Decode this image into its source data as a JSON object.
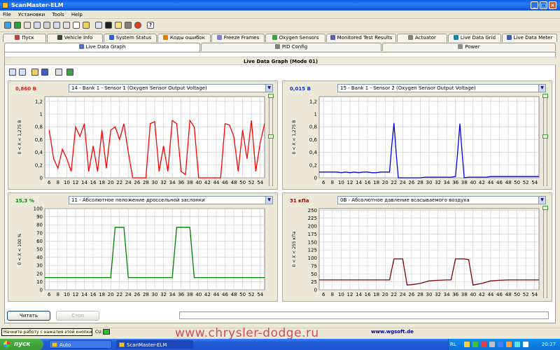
{
  "window": {
    "title": "ScanMaster-ELM"
  },
  "menu": [
    "File",
    "Установки",
    "Tools",
    "Help"
  ],
  "tabs_row1": [
    {
      "label": "Пуск",
      "icon": "start-icon",
      "color": "#c04040"
    },
    {
      "label": "Vehicle Info",
      "icon": "info-icon",
      "color": "#404040"
    },
    {
      "label": "System Status",
      "icon": "status-icon",
      "color": "#3060c0"
    },
    {
      "label": "Коды ошибок",
      "icon": "warning-icon",
      "color": "#e08000"
    },
    {
      "label": "Freeze Frames",
      "icon": "freeze-frames-icon",
      "color": "#8080c0"
    },
    {
      "label": "Oxygen Sensors",
      "icon": "oxygen-sensor-icon",
      "color": "#40a040"
    },
    {
      "label": "Monitored Test Results",
      "icon": "test-results-icon",
      "color": "#6060a0"
    },
    {
      "label": "Actuator",
      "icon": "actuator-icon",
      "color": "#808080"
    },
    {
      "label": "Live Data Grid",
      "icon": "grid-icon",
      "color": "#2080a0"
    },
    {
      "label": "Live Data Meter",
      "icon": "meter-icon",
      "color": "#4060a0"
    }
  ],
  "tabs_row2": [
    {
      "label": "Live Data Graph",
      "icon": "graph-icon",
      "active": true
    },
    {
      "label": "PID Config",
      "icon": "pid-config-icon",
      "active": false
    },
    {
      "label": "Power",
      "icon": "power-icon",
      "active": false
    }
  ],
  "panel_title": "Live Data Graph (Mode 01)",
  "graphs": [
    {
      "value": "0,860 В",
      "value_color": "#e02020",
      "sensor": "14 - Bank 1 - Sensor 1 (Oxygen Sensor Output Voltage)",
      "ylabel": "0   < X <   1,275 В",
      "line_color": "#ff0000",
      "chart_ref": 0
    },
    {
      "value": "0,015 В",
      "value_color": "#1030c0",
      "sensor": "15 - Bank 1 - Sensor 2 (Oxygen Sensor Output Voltage)",
      "ylabel": "0   < X <   1,275 В",
      "line_color": "#0000e0",
      "chart_ref": 1
    },
    {
      "value": "15,3 %",
      "value_color": "#108010",
      "sensor": "11 - Абсолютное положение дроссельной заслонки",
      "ylabel": "0   < X <   100  %",
      "line_color": "#008000",
      "chart_ref": 2
    },
    {
      "value": "31 кПа",
      "value_color": "#a00000",
      "sensor": "0B - Абсолютное давление всасываемого воздуха",
      "ylabel": "0   < X <   255 кПа",
      "line_color": "#800000",
      "chart_ref": 3
    }
  ],
  "chart_data": [
    {
      "type": "line",
      "x": [
        6,
        7,
        8,
        9,
        10,
        11,
        12,
        13,
        14,
        15,
        16,
        17,
        18,
        19,
        20,
        21,
        22,
        23,
        24,
        25,
        26,
        27,
        28,
        29,
        30,
        31,
        32,
        33,
        34,
        35,
        36,
        37,
        38,
        39,
        40,
        41,
        42,
        43,
        44,
        45,
        46,
        47,
        48,
        49,
        50,
        51,
        52,
        53,
        54,
        55
      ],
      "series": [
        {
          "values": [
            0.75,
            0.3,
            0.15,
            0.45,
            0.3,
            0.1,
            0.8,
            0.65,
            0.85,
            0.1,
            0.5,
            0.1,
            0.75,
            0.15,
            0.75,
            0.8,
            0.6,
            0.85,
            0.4,
            0,
            0,
            0,
            0,
            0.85,
            0.88,
            0.1,
            0.5,
            0.1,
            0.9,
            0.85,
            0.1,
            0.05,
            0.9,
            0.8,
            0,
            0,
            0,
            0,
            0,
            0,
            0.85,
            0.83,
            0.65,
            0.1,
            0.75,
            0.3,
            0.9,
            0.1,
            0.55,
            0.85
          ]
        }
      ],
      "xticks": [
        6,
        8,
        10,
        12,
        14,
        16,
        18,
        20,
        22,
        24,
        26,
        28,
        30,
        32,
        34,
        36,
        38,
        40,
        42,
        44,
        46,
        48,
        50,
        52,
        54
      ],
      "yticks": [
        0,
        0.2,
        0.4,
        0.6,
        0.8,
        1,
        1.2
      ],
      "ytick_labels": [
        "0",
        "0,2",
        "0,4",
        "0,6",
        "0,8",
        "1",
        "1,2"
      ],
      "xlim": [
        5,
        55
      ],
      "ylim": [
        0,
        1.275
      ]
    },
    {
      "type": "line",
      "x": [
        5,
        6,
        7,
        8,
        9,
        10,
        11,
        12,
        13,
        14,
        15,
        16,
        17,
        18,
        19,
        20,
        21,
        21.5,
        22,
        22.5,
        23,
        24,
        25,
        26,
        27,
        28,
        29,
        30,
        31,
        32,
        33,
        34,
        35,
        36,
        36.5,
        37,
        37.5,
        38,
        39,
        40,
        41,
        42,
        43,
        44,
        45,
        46,
        47,
        48,
        49,
        50,
        51,
        52,
        53,
        54,
        55
      ],
      "series": [
        {
          "values": [
            0.09,
            0.09,
            0.09,
            0.09,
            0.09,
            0.08,
            0.09,
            0.08,
            0.09,
            0.08,
            0.09,
            0.09,
            0.08,
            0.08,
            0.09,
            0.09,
            0.09,
            0.5,
            0.86,
            0.4,
            0,
            0,
            0,
            0,
            0,
            0,
            0.01,
            0.01,
            0.01,
            0.01,
            0.01,
            0.01,
            0.01,
            0.02,
            0.4,
            0.85,
            0.4,
            0,
            0.01,
            0.01,
            0.01,
            0.01,
            0.01,
            0.02,
            0.02,
            0.02,
            0.02,
            0.02,
            0.02,
            0.02,
            0.02,
            0.02,
            0.02,
            0.02,
            0.02
          ]
        }
      ],
      "xticks": [
        6,
        8,
        10,
        12,
        14,
        16,
        18,
        20,
        22,
        24,
        26,
        28,
        30,
        32,
        34,
        36,
        38,
        40,
        42,
        44,
        46,
        48,
        50,
        52,
        54
      ],
      "yticks": [
        0,
        0.2,
        0.4,
        0.6,
        0.8,
        1,
        1.2
      ],
      "ytick_labels": [
        "0",
        "0,2",
        "0,4",
        "0,6",
        "0,8",
        "1",
        "1,2"
      ],
      "xlim": [
        5,
        55
      ],
      "ylim": [
        0,
        1.275
      ]
    },
    {
      "type": "line",
      "x": [
        5,
        19,
        20,
        21,
        22,
        23,
        24,
        25,
        26,
        27,
        34,
        35,
        36,
        37,
        38,
        39,
        40,
        55
      ],
      "series": [
        {
          "values": [
            15,
            15,
            15,
            77,
            77,
            77,
            15,
            15,
            15,
            15,
            15,
            77,
            77,
            77,
            77,
            15,
            15,
            15
          ]
        }
      ],
      "xticks": [
        6,
        8,
        10,
        12,
        14,
        16,
        18,
        20,
        22,
        24,
        26,
        28,
        30,
        32,
        34,
        36,
        38,
        40,
        42,
        44,
        46,
        48,
        50,
        52,
        54
      ],
      "yticks": [
        0,
        10,
        20,
        30,
        40,
        50,
        60,
        70,
        80,
        90,
        100
      ],
      "ytick_labels": [
        "0",
        "10",
        "20",
        "30",
        "40",
        "50",
        "60",
        "70",
        "80",
        "90",
        "100"
      ],
      "xlim": [
        5,
        55
      ],
      "ylim": [
        0,
        100
      ]
    },
    {
      "type": "line",
      "x": [
        5,
        10,
        20,
        21,
        22,
        24,
        25,
        26,
        28,
        30,
        32,
        34,
        35,
        36,
        38,
        39,
        40,
        42,
        44,
        46,
        48,
        50,
        52,
        55
      ],
      "series": [
        {
          "values": [
            31,
            31,
            31,
            31,
            97,
            97,
            15,
            16,
            20,
            28,
            30,
            31,
            31,
            97,
            97,
            95,
            15,
            20,
            28,
            30,
            31,
            31,
            31,
            31
          ]
        }
      ],
      "xticks": [
        6,
        8,
        10,
        12,
        14,
        16,
        18,
        20,
        22,
        24,
        26,
        28,
        30,
        32,
        34,
        36,
        38,
        40,
        42,
        44,
        46,
        48,
        50,
        52,
        54
      ],
      "yticks": [
        0,
        25,
        50,
        75,
        100,
        125,
        150,
        175,
        200,
        225,
        250
      ],
      "ytick_labels": [
        "0",
        "25",
        "50",
        "75",
        "100",
        "125",
        "150",
        "175",
        "200",
        "225",
        "250"
      ],
      "xlim": [
        5,
        55
      ],
      "ylim": [
        0,
        255
      ]
    }
  ],
  "buttons": {
    "read": "Читать",
    "stop": "Стоп"
  },
  "status": {
    "tooltip": "Начните работу с нажатия этой кнопки",
    "cu_label": "CU:",
    "url": "www.wgsoft.de"
  },
  "watermark": "www.chrysler-dodge.ru",
  "taskbar": {
    "start": "пуск",
    "items": [
      "Auto",
      "ScanMaster-ELM"
    ],
    "lang": "RL",
    "clock": "20:27"
  }
}
